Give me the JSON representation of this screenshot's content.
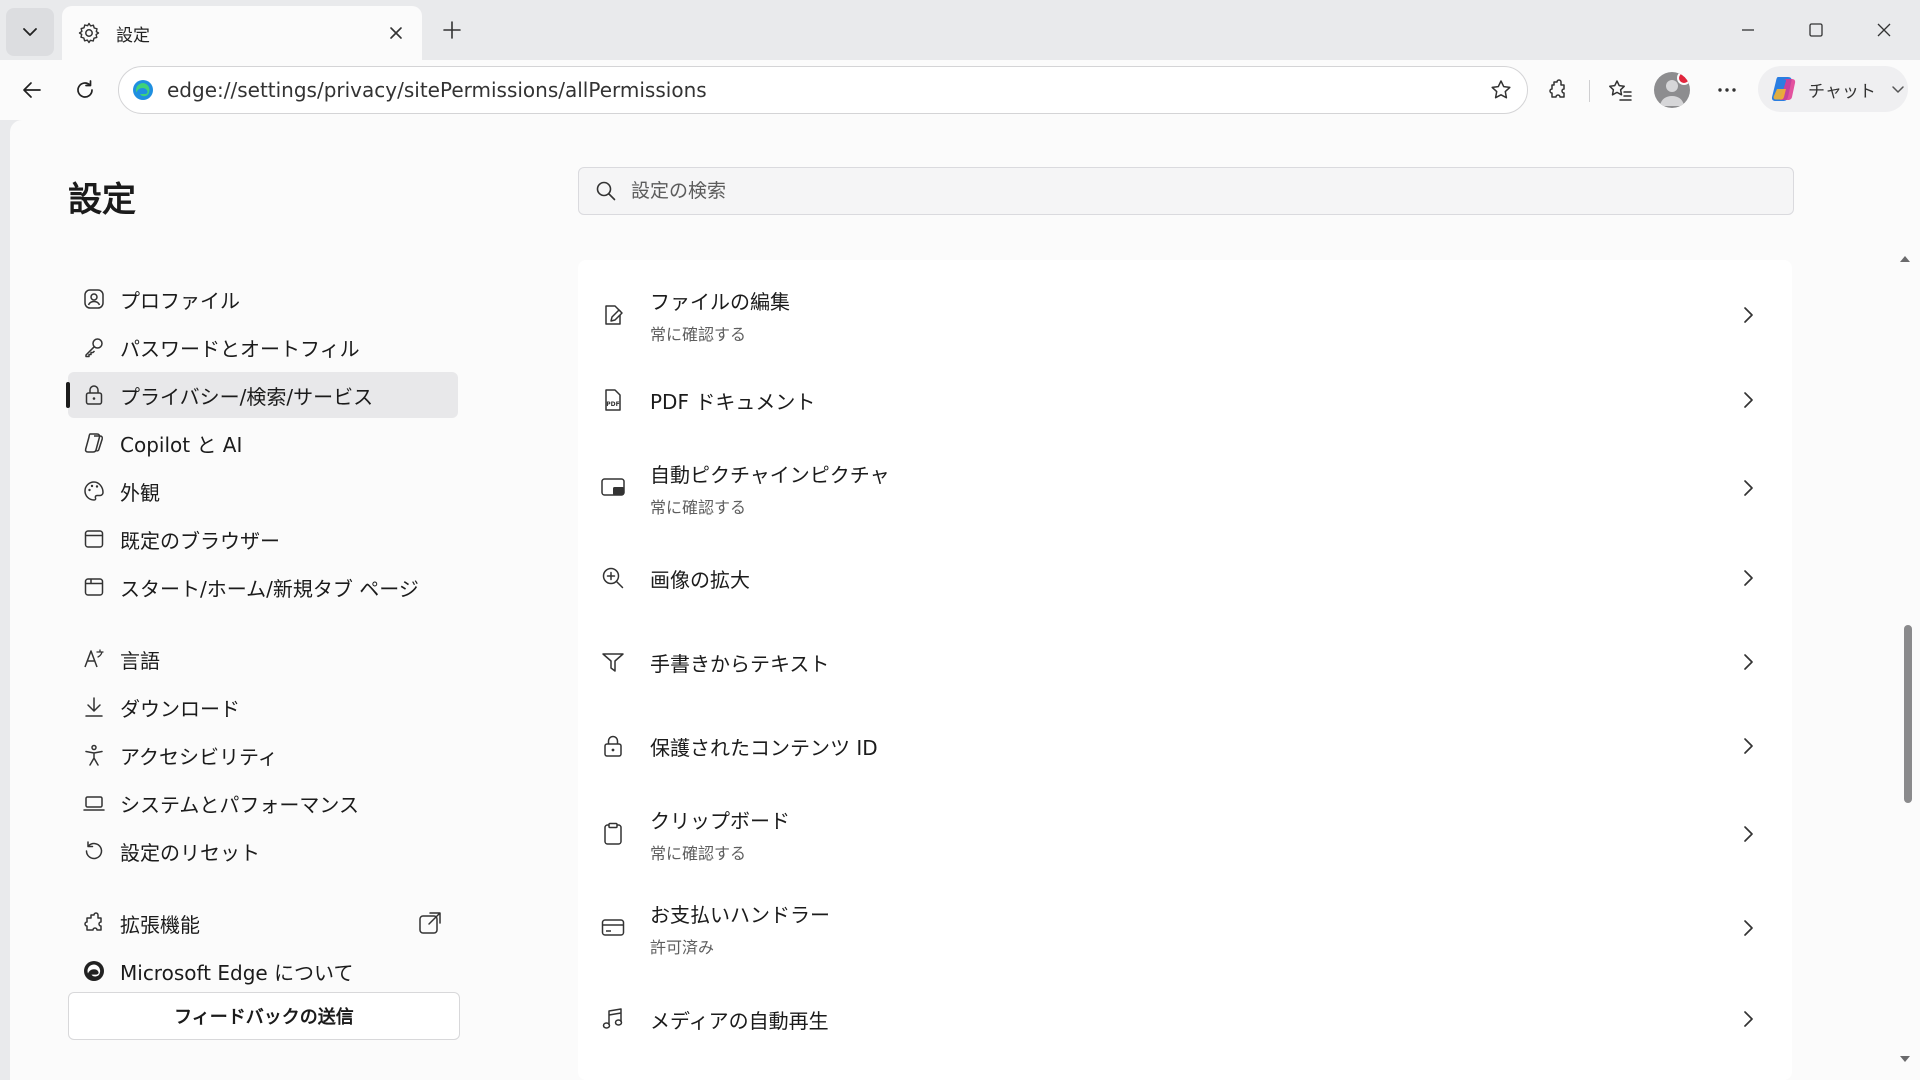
{
  "tab": {
    "title": "設定",
    "favicon": "gear-icon"
  },
  "address_bar": {
    "url": "edge://settings/privacy/sitePermissions/allPermissions"
  },
  "toolbar": {
    "copilot_label": "チャット"
  },
  "page": {
    "title": "設定",
    "search_placeholder": "設定の検索"
  },
  "nav": {
    "items": [
      {
        "label": "プロファイル",
        "icon": "profile-icon"
      },
      {
        "label": "パスワードとオートフィル",
        "icon": "key-icon"
      },
      {
        "label": "プライバシー/検索/サービス",
        "icon": "lock-icon",
        "active": true
      },
      {
        "label": "Copilot と AI",
        "icon": "copilot-icon"
      },
      {
        "label": "外観",
        "icon": "palette-icon"
      },
      {
        "label": "既定のブラウザー",
        "icon": "browser-icon"
      },
      {
        "label": "スタート/ホーム/新規タブ ページ",
        "icon": "home-page-icon"
      },
      {
        "label": "言語",
        "icon": "language-icon"
      },
      {
        "label": "ダウンロード",
        "icon": "download-icon"
      },
      {
        "label": "アクセシビリティ",
        "icon": "accessibility-icon"
      },
      {
        "label": "システムとパフォーマンス",
        "icon": "laptop-icon"
      },
      {
        "label": "設定のリセット",
        "icon": "reset-icon"
      },
      {
        "label": "拡張機能",
        "icon": "extensions-icon"
      },
      {
        "label": "Microsoft Edge について",
        "icon": "edge-logo-icon"
      }
    ],
    "feedback_label": "フィードバックの送信"
  },
  "permissions": {
    "items": [
      {
        "label": "ファイルの編集",
        "status": "常に確認する",
        "icon": "file-edit-icon"
      },
      {
        "label": "PDF ドキュメント",
        "icon": "pdf-icon"
      },
      {
        "label": "自動ピクチャインピクチャ",
        "status": "常に確認する",
        "icon": "picture-in-picture-icon"
      },
      {
        "label": "画像の拡大",
        "icon": "zoom-in-icon"
      },
      {
        "label": "手書きからテキスト",
        "icon": "handwriting-icon"
      },
      {
        "label": "保護されたコンテンツ ID",
        "icon": "lock-icon"
      },
      {
        "label": "クリップボード",
        "status": "常に確認する",
        "icon": "clipboard-icon"
      },
      {
        "label": "お支払いハンドラー",
        "status": "許可済み",
        "icon": "card-icon"
      },
      {
        "label": "メディアの自動再生",
        "icon": "music-note-icon"
      }
    ]
  }
}
